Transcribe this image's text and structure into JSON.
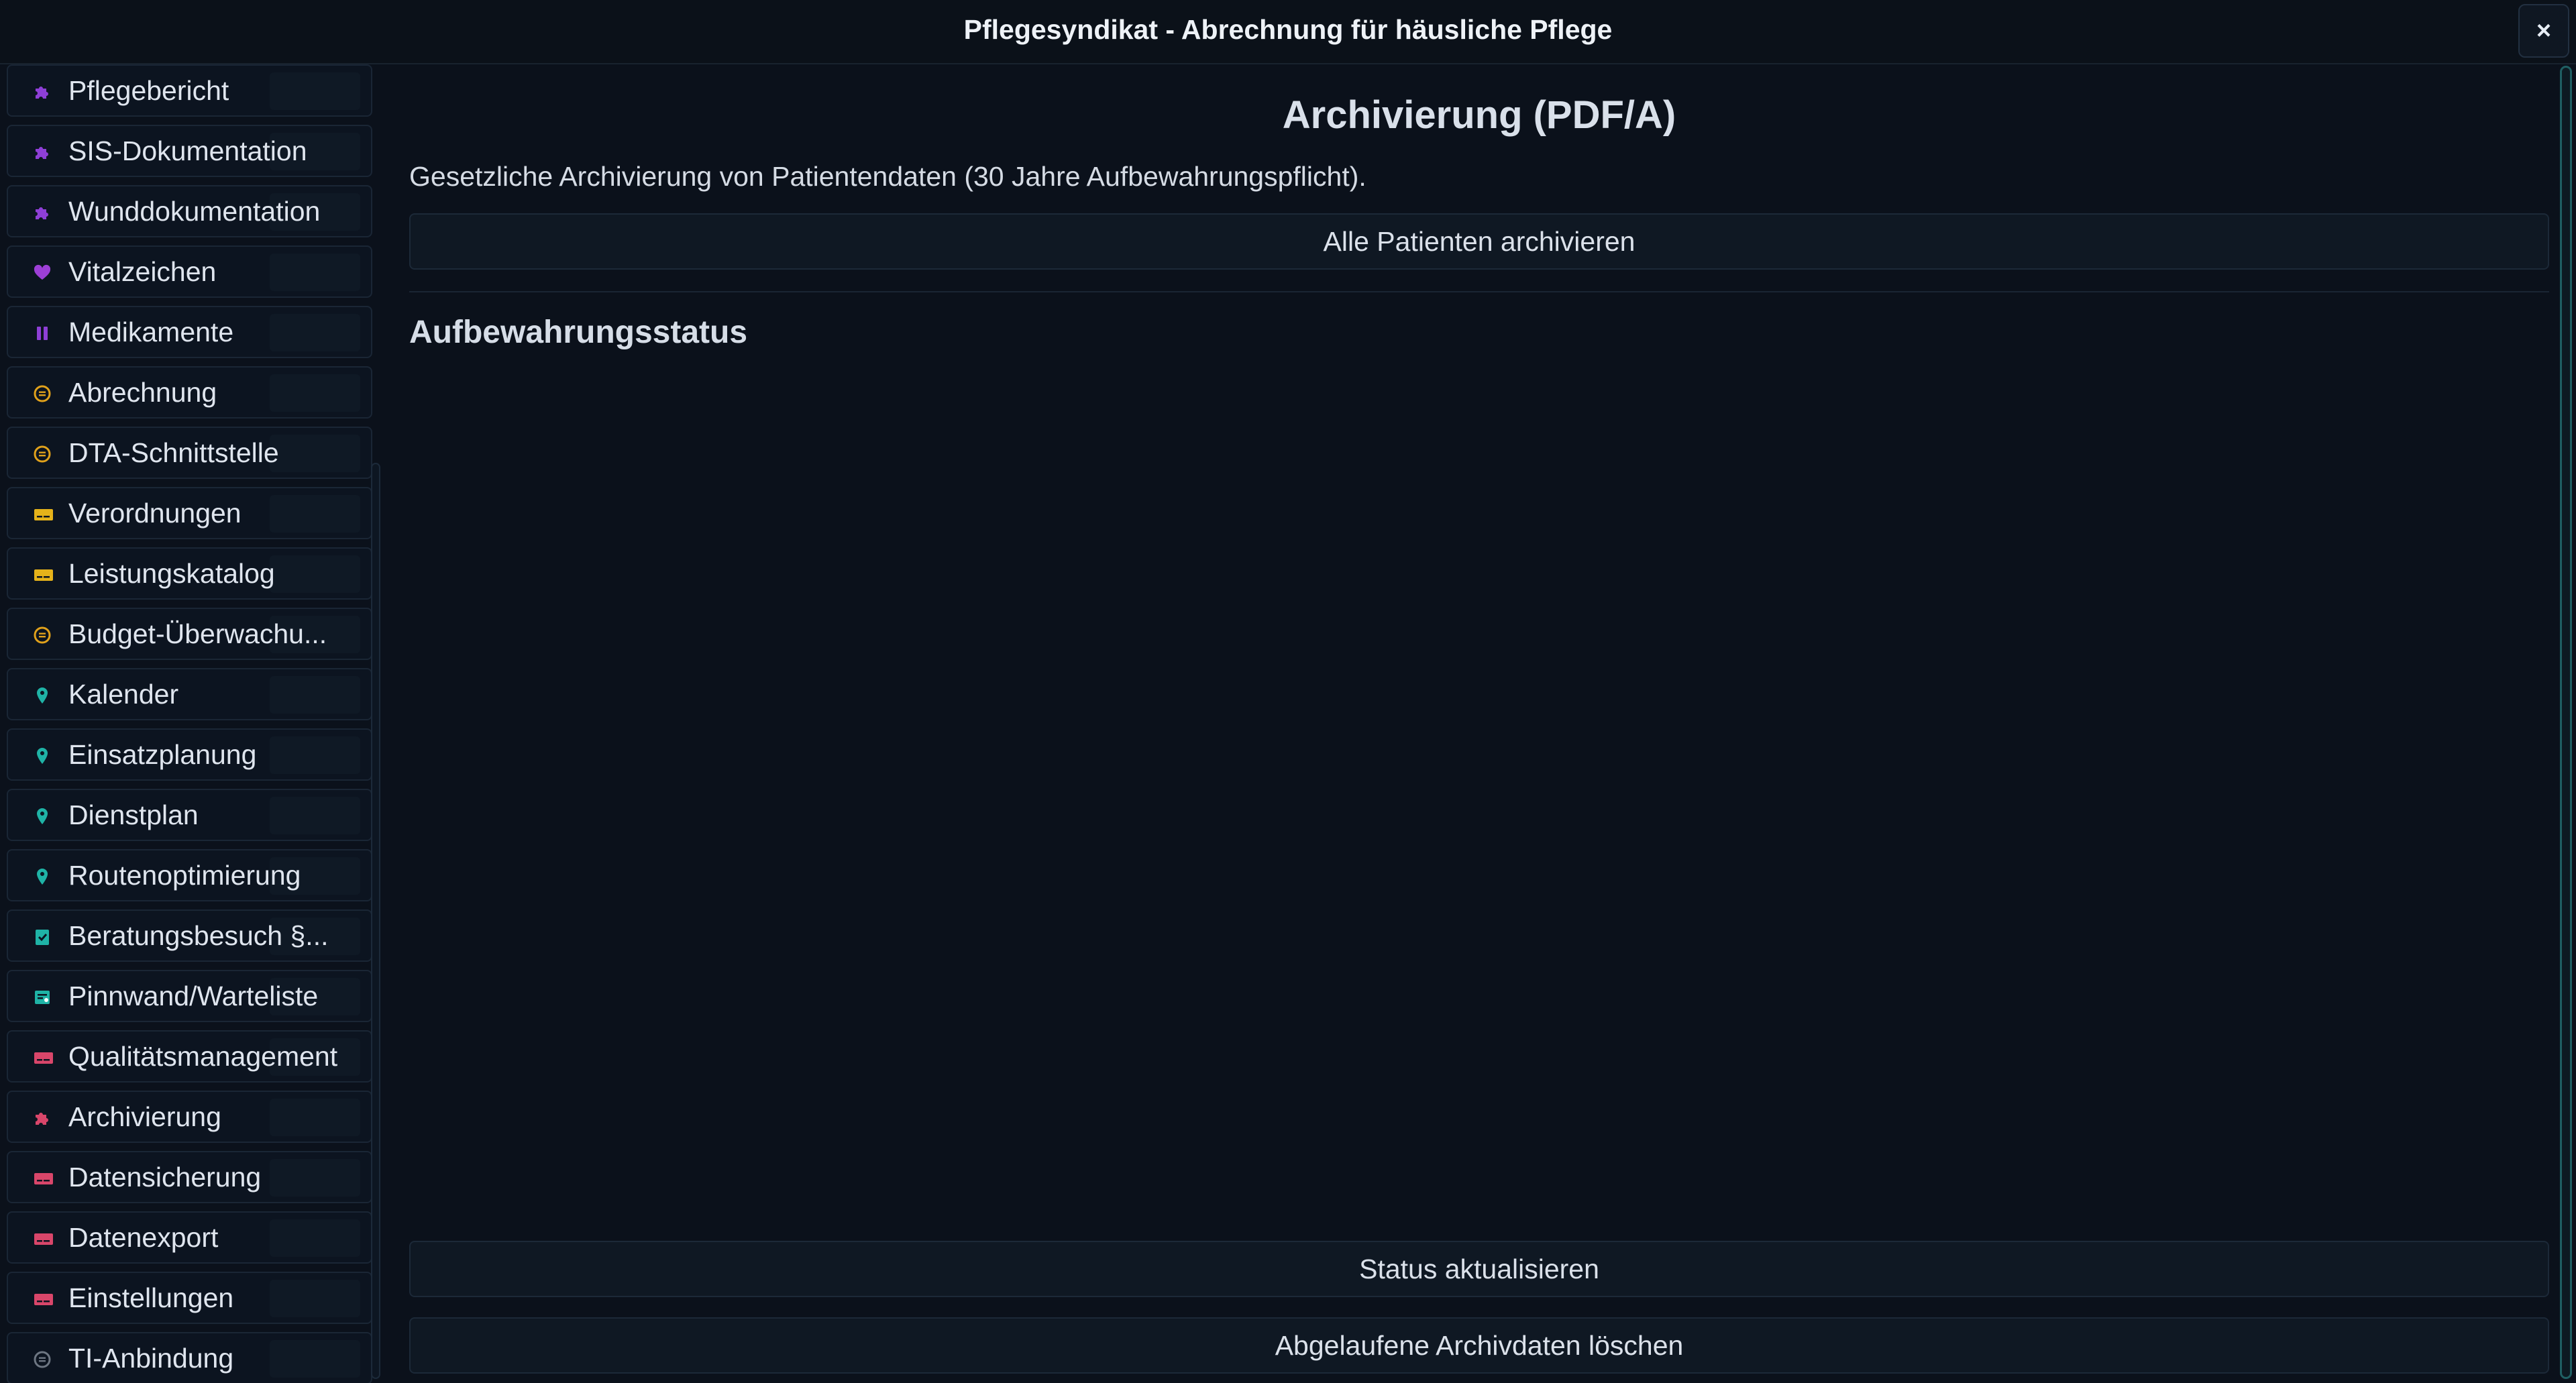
{
  "window": {
    "title": "Pflegesyndikat - Abrechnung für häusliche Pflege",
    "close_glyph": "×"
  },
  "sidebar": {
    "items": [
      {
        "label": "Pflegebericht",
        "icon": "puzzle-icon",
        "color": "#8e3fd6"
      },
      {
        "label": "SIS-Dokumentation",
        "icon": "puzzle-icon",
        "color": "#8e3fd6"
      },
      {
        "label": "Wunddokumentation",
        "icon": "puzzle-icon",
        "color": "#8e3fd6"
      },
      {
        "label": "Vitalzeichen",
        "icon": "heart-icon",
        "color": "#9d3fd6"
      },
      {
        "label": "Medikamente",
        "icon": "pause-icon",
        "color": "#8e3fd6"
      },
      {
        "label": "Abrechnung",
        "icon": "coin-icon",
        "color": "#e0a11b"
      },
      {
        "label": "DTA-Schnittstelle",
        "icon": "coin-icon",
        "color": "#e0a11b"
      },
      {
        "label": "Verordnungen",
        "icon": "card-icon",
        "color": "#e5b21a"
      },
      {
        "label": "Leistungskatalog",
        "icon": "card-icon",
        "color": "#e5b21a"
      },
      {
        "label": "Budget-Überwachu...",
        "icon": "coin-icon",
        "color": "#e0a11b"
      },
      {
        "label": "Kalender",
        "icon": "pin-icon",
        "color": "#1fb3a6"
      },
      {
        "label": "Einsatzplanung",
        "icon": "pin-icon",
        "color": "#1fb3a6"
      },
      {
        "label": "Dienstplan",
        "icon": "pin-icon",
        "color": "#1fb3a6"
      },
      {
        "label": "Routenoptimierung",
        "icon": "pin-icon",
        "color": "#1fb3a6"
      },
      {
        "label": "Beratungsbesuch §...",
        "icon": "clipboard-check-icon",
        "color": "#1fb3a6"
      },
      {
        "label": "Pinnwand/Warteliste",
        "icon": "note-icon",
        "color": "#1fb3a6"
      },
      {
        "label": "Qualitätsmanagement",
        "icon": "card-icon",
        "color": "#d9466a"
      },
      {
        "label": "Archivierung",
        "icon": "puzzle-icon",
        "color": "#d9466a"
      },
      {
        "label": "Datensicherung",
        "icon": "card-icon",
        "color": "#d9466a"
      },
      {
        "label": "Datenexport",
        "icon": "card-icon",
        "color": "#d9466a"
      },
      {
        "label": "Einstellungen",
        "icon": "card-icon",
        "color": "#d9466a"
      },
      {
        "label": "TI-Anbindung",
        "icon": "coin-icon",
        "color": "#6d7682"
      }
    ]
  },
  "main": {
    "heading": "Archivierung (PDF/A)",
    "description": "Gesetzliche Archivierung von Patientendaten (30 Jahre Aufbewahrungspflicht).",
    "archive_all_label": "Alle Patienten archivieren",
    "section_title": "Aufbewahrungsstatus",
    "refresh_label": "Status aktualisieren",
    "delete_expired_label": "Abgelaufene Archivdaten löschen"
  }
}
